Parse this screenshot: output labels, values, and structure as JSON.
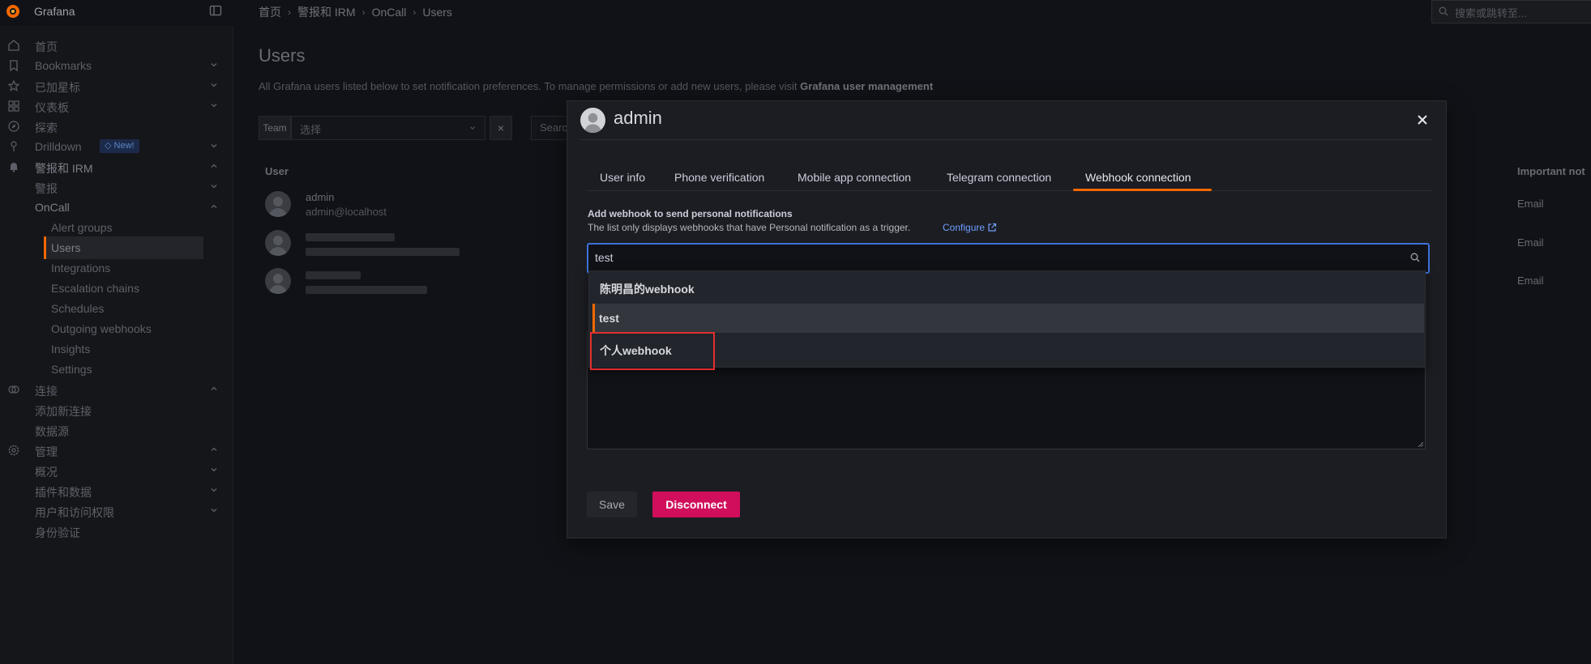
{
  "topbar": {
    "brand": "Grafana",
    "breadcrumbs": [
      "首页",
      "警报和 IRM",
      "OnCall",
      "Users"
    ],
    "search_placeholder": "搜索或跳转至..."
  },
  "sidebar": {
    "items": [
      {
        "label": "首页",
        "icon": "home-icon"
      },
      {
        "label": "Bookmarks",
        "icon": "bookmark-icon"
      },
      {
        "label": "已加星标",
        "icon": "star-icon"
      },
      {
        "label": "仪表板",
        "icon": "dashboard-icon"
      },
      {
        "label": "探索",
        "icon": "compass-icon"
      },
      {
        "label": "Drilldown",
        "icon": "drilldown-icon",
        "badge": "New!"
      },
      {
        "label": "警报和 IRM",
        "icon": "bell-icon"
      },
      {
        "label": "警报"
      },
      {
        "label": "OnCall"
      },
      {
        "label": "Alert groups"
      },
      {
        "label": "Users"
      },
      {
        "label": "Integrations"
      },
      {
        "label": "Escalation chains"
      },
      {
        "label": "Schedules"
      },
      {
        "label": "Outgoing webhooks"
      },
      {
        "label": "Insights"
      },
      {
        "label": "Settings"
      },
      {
        "label": "连接",
        "icon": "connections-icon"
      },
      {
        "label": "添加新连接"
      },
      {
        "label": "数据源"
      },
      {
        "label": "管理",
        "icon": "cog-icon"
      },
      {
        "label": "概况"
      },
      {
        "label": "插件和数据"
      },
      {
        "label": "用户和访问权限"
      },
      {
        "label": "身份验证"
      }
    ]
  },
  "main": {
    "title": "Users",
    "description_prefix": "All Grafana users listed below to set notification preferences. To manage permissions or add new users, please visit ",
    "description_link": "Grafana user management",
    "team_label": "Team",
    "team_placeholder": "选择",
    "team_clear": "×",
    "search_placeholder": "Searc",
    "columns": {
      "user": "User",
      "important": "Important not"
    },
    "users": [
      {
        "name": "admin",
        "email": "admin@localhost",
        "notify": "Email"
      },
      {
        "name": "",
        "email": "",
        "notify": "Email"
      },
      {
        "name": "",
        "email": "",
        "notify": "Email"
      }
    ]
  },
  "modal": {
    "title": "admin",
    "tabs": [
      "User info",
      "Phone verification",
      "Mobile app connection",
      "Telegram connection",
      "Webhook connection"
    ],
    "active_tab": "Webhook connection",
    "section_title": "Add webhook to send personal notifications",
    "section_desc": "The list only displays webhooks that have Personal notification as a trigger.",
    "configure_link": "Configure",
    "combo_value": "test",
    "options": [
      "陈明昌的webhook",
      "test",
      "个人webhook"
    ],
    "selected_option": "test",
    "save_label": "Save",
    "disconnect_label": "Disconnect"
  },
  "colors": {
    "accent": "#f46800",
    "danger": "#d10e5c",
    "focus": "#3d71d9",
    "annotation": "#e02f2f"
  }
}
